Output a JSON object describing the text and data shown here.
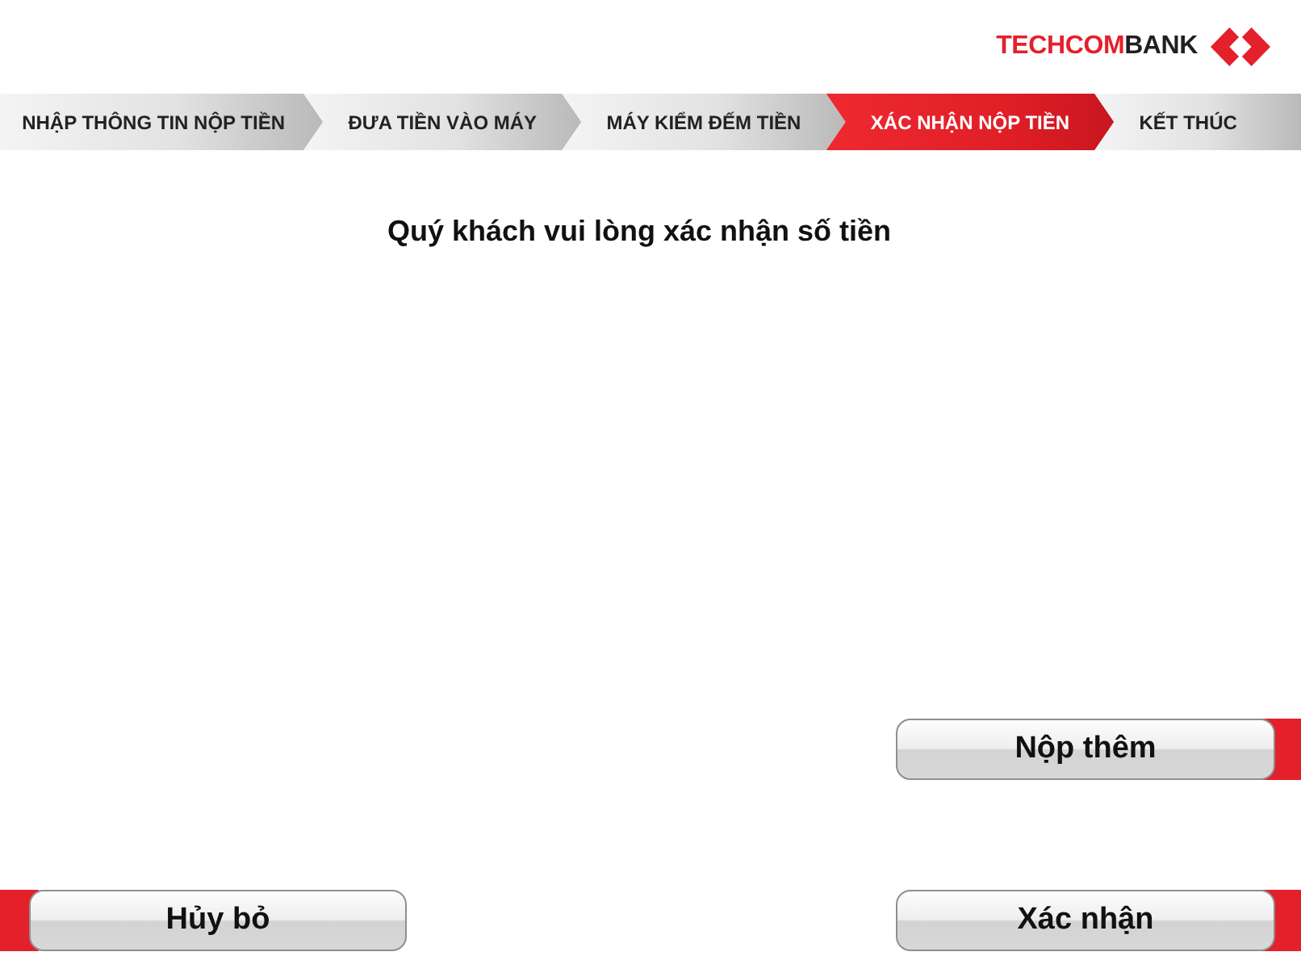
{
  "logo": {
    "wordmark": [
      {
        "text": "TECHCOM",
        "color": "#e4202b"
      },
      {
        "text": "BANK",
        "color": "#231f20"
      }
    ]
  },
  "steps": [
    {
      "label": "NHẬP THÔNG TIN NỘP TIỀN",
      "selected": false
    },
    {
      "label": "ĐƯA TIỀN VÀO MÁY",
      "selected": false
    },
    {
      "label": "MÁY KIỂM ĐẾM TIỀN",
      "selected": false
    },
    {
      "label": "XÁC NHẬN NỘP TIỀN",
      "selected": true
    },
    {
      "label": "KẾT THÚC",
      "selected": false
    }
  ],
  "prompt": "Quý khách vui lòng xác nhận số tiền",
  "buttons": [
    {
      "label": "Nộp thêm",
      "kind": "right"
    },
    {
      "label": "Hủy bỏ",
      "kind": "left"
    },
    {
      "label": "Xác nhận",
      "kind": "right"
    }
  ]
}
